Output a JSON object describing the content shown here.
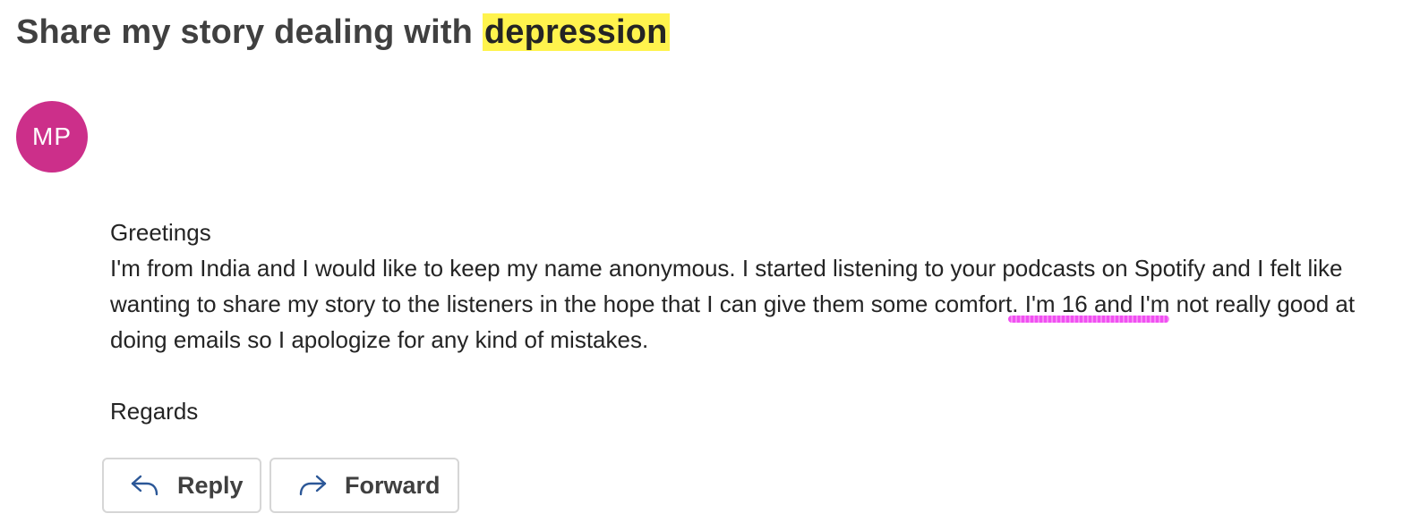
{
  "email": {
    "subject_prefix": "Share my story dealing with ",
    "subject_highlight": "depression",
    "highlight_color": "#fff34d",
    "sender_initials": "MP",
    "avatar_color": "#cc2f8a",
    "greeting": "Greetings",
    "paragraph_part1": "I'm from India and I would like to keep my name anonymous. I started listening to your podcasts on Spotify and I felt like wanting to share my story to the listeners in the hope that I can give them some comfort",
    "paragraph_marked": ". I'm 16 and I'm",
    "paragraph_part2": " not really good at doing emails so I apologize for any kind of mistakes.",
    "signoff": "Regards"
  },
  "actions": {
    "reply_label": "Reply",
    "reply_icon": "reply-arrow-icon",
    "forward_label": "Forward",
    "forward_icon": "forward-arrow-icon"
  }
}
